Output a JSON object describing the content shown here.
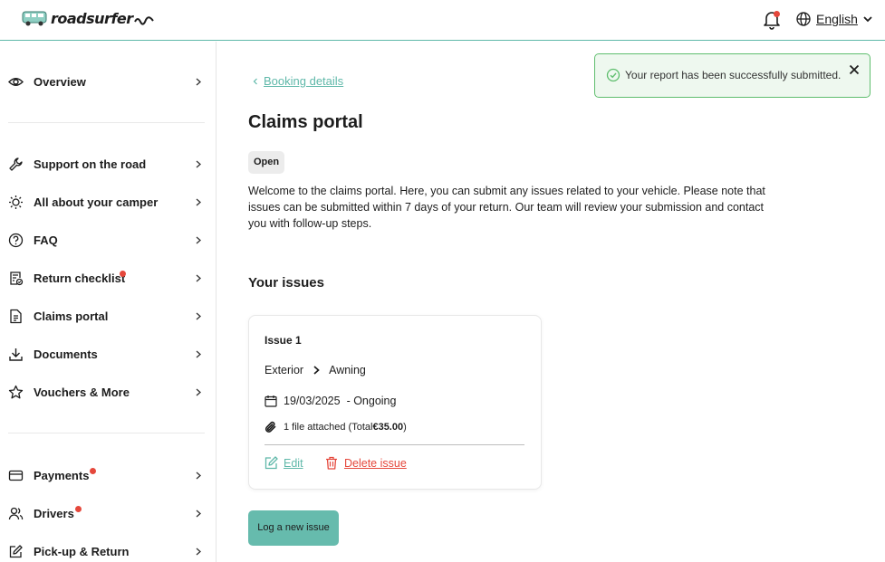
{
  "header": {
    "logo_text": "roadsurfer",
    "language": "English",
    "icons": {
      "bell": "bell-icon",
      "globe": "globe-icon",
      "chevron": "chevron-down-icon"
    }
  },
  "sidebar": {
    "items": [
      {
        "label": "Overview",
        "icon": "eye-icon",
        "has_dot": false
      },
      {
        "label": "Support on the road",
        "icon": "wrench-icon",
        "has_dot": false
      },
      {
        "label": "All about your camper",
        "icon": "bulb-icon",
        "has_dot": false
      },
      {
        "label": "FAQ",
        "icon": "question-icon",
        "has_dot": false
      },
      {
        "label": "Return checklist",
        "icon": "checklist-icon",
        "has_dot": true
      },
      {
        "label": "Claims portal",
        "icon": "document-icon",
        "has_dot": false
      },
      {
        "label": "Documents",
        "icon": "download-icon",
        "has_dot": false
      },
      {
        "label": "Vouchers & More",
        "icon": "star-icon",
        "has_dot": false
      },
      {
        "label": "Payments",
        "icon": "card-icon",
        "has_dot": true
      },
      {
        "label": "Drivers",
        "icon": "users-icon",
        "has_dot": true
      },
      {
        "label": "Pick-up & Return",
        "icon": "edit-icon",
        "has_dot": false
      }
    ]
  },
  "main": {
    "back_link": "Booking details",
    "title": "Claims portal",
    "status": "Open",
    "intro": "Welcome to the claims portal. Here, you can submit any issues related to your vehicle. Please note that issues can be submitted within 7 days of your return. Our team will review your submission and contact you with follow-up steps.",
    "issues_title": "Your issues",
    "issues": [
      {
        "name": "Issue 1",
        "category": "Exterior",
        "subcategory": "Awning",
        "date": "19/03/2025",
        "state": "- Ongoing",
        "files_text": "1 file attached (Total ",
        "files_total": "€35.00",
        "files_close": ")",
        "edit_label": "Edit",
        "delete_label": "Delete issue"
      }
    ],
    "log_button": "Log a new issue"
  },
  "toast": {
    "message": "Your report has been successfully submitted."
  },
  "colors": {
    "accent": "#5fb8a9",
    "button": "#66bbad",
    "danger": "#e5483c",
    "success_border": "#5fbe6e",
    "success_bg": "#eef8ef"
  }
}
